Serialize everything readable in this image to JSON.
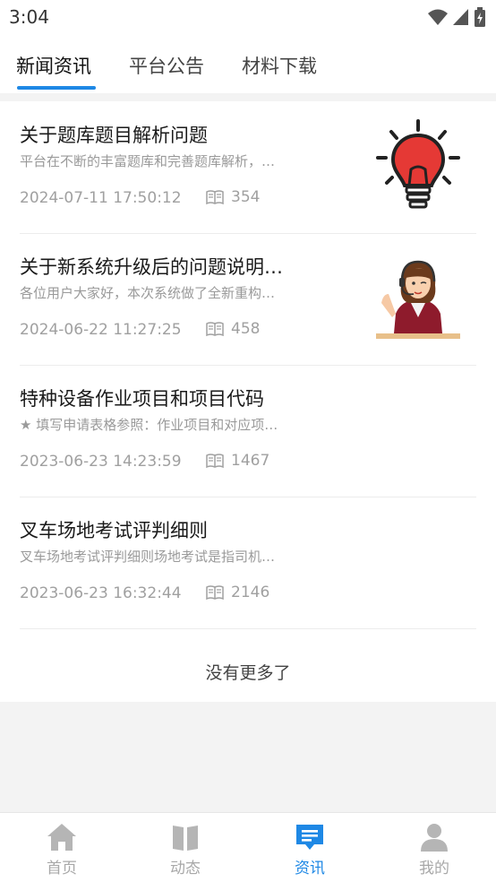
{
  "status_bar": {
    "time": "3:04"
  },
  "tabs": [
    {
      "label": "新闻资讯",
      "active": true
    },
    {
      "label": "平台公告",
      "active": false
    },
    {
      "label": "材料下载",
      "active": false
    }
  ],
  "news": [
    {
      "title": "关于题库题目解析问题",
      "summary": "平台在不断的丰富题库和完善题库解析，…",
      "date": "2024-07-11 17:50:12",
      "views": "354",
      "thumbnail": "lightbulb-illustration"
    },
    {
      "title": "关于新系统升级后的问题说明…",
      "summary": "各位用户大家好，本次系统做了全新重构…",
      "date": "2024-06-22 11:27:25",
      "views": "458",
      "thumbnail": "customer-service-illustration"
    },
    {
      "title": "特种设备作业项目和项目代码",
      "summary": "★ 填写申请表格参照：作业项目和对应项…",
      "date": "2023-06-23 14:23:59",
      "views": "1467"
    },
    {
      "title": "叉车场地考试评判细则",
      "summary": "叉车场地考试评判细则场地考试是指司机…",
      "date": "2023-06-23 16:32:44",
      "views": "2146"
    }
  ],
  "list_footer": "没有更多了",
  "bottom_nav": [
    {
      "label": "首页",
      "icon": "home-icon",
      "active": false
    },
    {
      "label": "动态",
      "icon": "book-icon",
      "active": false
    },
    {
      "label": "资讯",
      "icon": "message-icon",
      "active": true
    },
    {
      "label": "我的",
      "icon": "user-icon",
      "active": false
    }
  ],
  "colors": {
    "accent": "#1e88e5",
    "inactive": "#a8a8a8",
    "bulb_red": "#e53935"
  }
}
